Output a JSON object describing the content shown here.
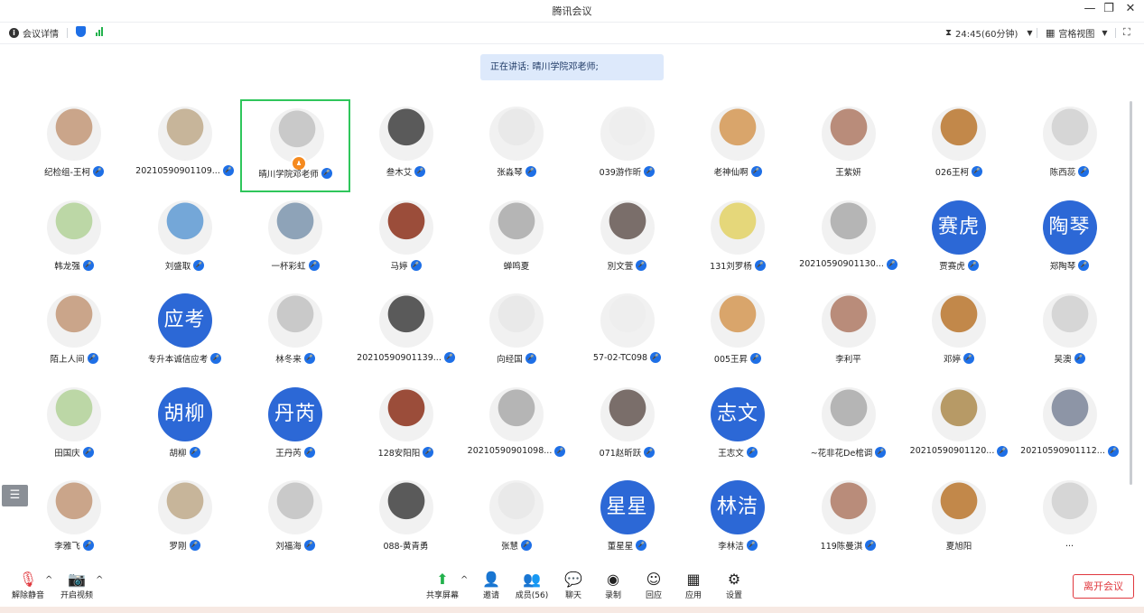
{
  "window": {
    "title": "腾讯会议"
  },
  "toolbar": {
    "meeting_details": "会议详情",
    "timer": "24:45(60分钟)",
    "view_mode": "宫格视图"
  },
  "speaking": {
    "text": "正在讲话: 晴川学院邓老师;"
  },
  "participants": [
    {
      "name": "纪检组-王柯"
    },
    {
      "name": "20210590901109..."
    },
    {
      "name": "晴川学院邓老师"
    },
    {
      "name": "叁木艾"
    },
    {
      "name": "张淼琴"
    },
    {
      "name": "039游作昕"
    },
    {
      "name": "老神仙啊"
    },
    {
      "name": "王紫妍",
      "no_mic": true
    },
    {
      "name": "026王柯"
    },
    {
      "name": "陈西蕊"
    },
    {
      "name": "韩龙强"
    },
    {
      "name": "刘盛取"
    },
    {
      "name": "一杯彩虹"
    },
    {
      "name": "马婷"
    },
    {
      "name": "蝉鸣夏",
      "no_mic": true
    },
    {
      "name": "別文萱"
    },
    {
      "name": "131刘罗杨"
    },
    {
      "name": "20210590901130..."
    },
    {
      "name": "贾赛虎",
      "avatar_text": "赛虎"
    },
    {
      "name": "郑陶琴",
      "avatar_text": "陶琴"
    },
    {
      "name": "陌上人间"
    },
    {
      "name": "专升本诚信应考",
      "avatar_text": "应考"
    },
    {
      "name": "林冬来"
    },
    {
      "name": "20210590901139..."
    },
    {
      "name": "向经国"
    },
    {
      "name": "57-02-TC098"
    },
    {
      "name": "005王昇"
    },
    {
      "name": "李利平",
      "no_mic": true
    },
    {
      "name": "邓婷"
    },
    {
      "name": "吴澳"
    },
    {
      "name": "田国庆"
    },
    {
      "name": "胡柳",
      "avatar_text": "胡柳"
    },
    {
      "name": "王丹芮",
      "avatar_text": "丹芮"
    },
    {
      "name": "128安阳阳"
    },
    {
      "name": "20210590901098..."
    },
    {
      "name": "071赵昕跃"
    },
    {
      "name": "王志文",
      "avatar_text": "志文"
    },
    {
      "name": "~花非花De棺调"
    },
    {
      "name": "20210590901120..."
    },
    {
      "name": "20210590901112..."
    },
    {
      "name": "李雅飞"
    },
    {
      "name": "罗刚"
    },
    {
      "name": "刘福海"
    },
    {
      "name": "088-黄青勇",
      "no_mic": true
    },
    {
      "name": "张慧"
    },
    {
      "name": "董星星",
      "avatar_text": "星星"
    },
    {
      "name": "李林洁",
      "avatar_text": "林洁"
    },
    {
      "name": "119陈曼淇"
    },
    {
      "name": "夏旭阳",
      "no_mic": true
    },
    {
      "name": "...",
      "no_mic": true
    }
  ],
  "bottom": {
    "unmute": "解除静音",
    "start_video": "开启视频",
    "share_screen": "共享屏幕",
    "invite": "邀请",
    "members": "成员(56)",
    "chat": "聊天",
    "record": "录制",
    "react": "回应",
    "apps": "应用",
    "settings": "设置",
    "leave": "离开会议"
  },
  "colors": {
    "accent": "#1e6fe6",
    "speaker_bg": "#dde9fb",
    "active_border": "#2fc65b",
    "leave": "#e0383e",
    "text_avatar": "#2c68d6"
  }
}
